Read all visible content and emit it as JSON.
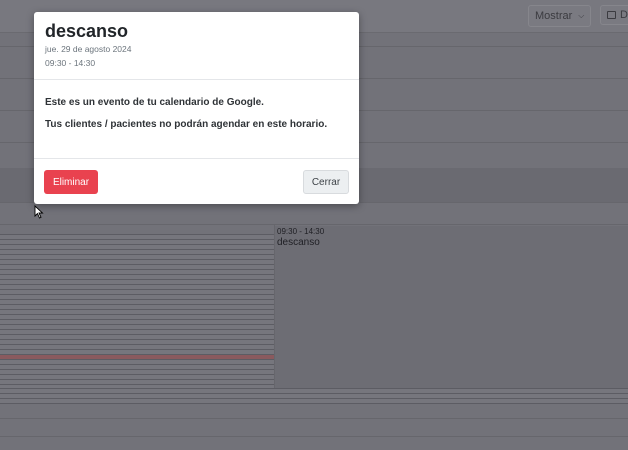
{
  "toolbar": {
    "show_label": "Mostrar",
    "view_label": "D",
    "show_icon": "chevron-down-icon",
    "view_icon": "calendar-icon"
  },
  "calendar": {
    "event": {
      "time": "09:30 - 14:30",
      "title": "descanso"
    }
  },
  "modal": {
    "title": "descanso",
    "date": "jue. 29 de agosto 2024",
    "time": "09:30 - 14:30",
    "line1": "Este es un evento de tu calendario de Google.",
    "line2": "Tus clientes / pacientes no podrán agendar en este horario.",
    "delete_label": "Eliminar",
    "close_label": "Cerrar"
  },
  "colors": {
    "overlay": "#727279",
    "delete": "#e9424f",
    "close": "#eceff1"
  }
}
